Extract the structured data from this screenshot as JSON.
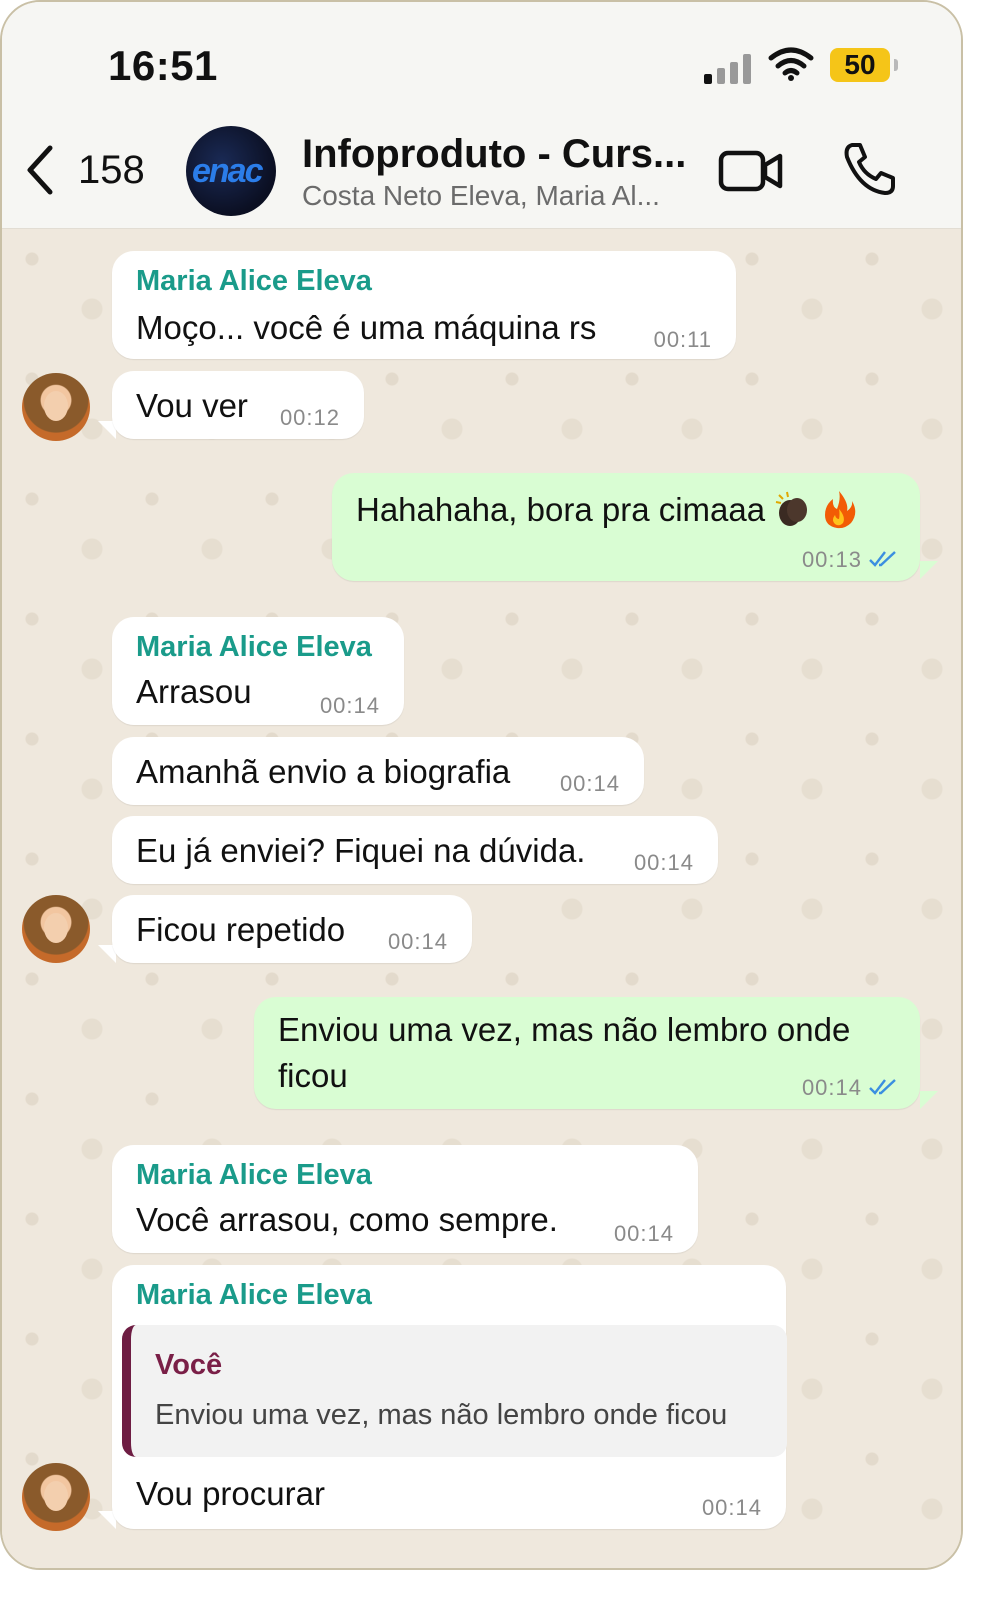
{
  "status": {
    "time": "16:51",
    "battery": "50"
  },
  "header": {
    "back_count": "158",
    "avatar_text": "enac",
    "title": "Infoproduto - Curs...",
    "subtitle": "Costa Neto Eleva, Maria Al..."
  },
  "messages": [
    {
      "type": "in",
      "sender": "Maria Alice Eleva",
      "text": "Moço... você é uma máquina rs",
      "time": "00:11"
    },
    {
      "type": "in",
      "text": "Vou ver",
      "time": "00:12"
    },
    {
      "type": "out",
      "text": "Hahahaha, bora pra cimaaa",
      "emojis": [
        "clapping-hands",
        "fire"
      ],
      "time": "00:13",
      "status": "read"
    },
    {
      "type": "in",
      "sender": "Maria Alice Eleva",
      "text": "Arrasou",
      "time": "00:14"
    },
    {
      "type": "in",
      "text": "Amanhã envio a biografia",
      "time": "00:14"
    },
    {
      "type": "in",
      "text": "Eu já enviei? Fiquei na dúvida.",
      "time": "00:14"
    },
    {
      "type": "in",
      "text": "Ficou repetido",
      "time": "00:14"
    },
    {
      "type": "out",
      "text_line1": "Enviou uma vez, mas não lembro onde",
      "text_line2": "ficou",
      "time": "00:14",
      "status": "read"
    },
    {
      "type": "in",
      "sender": "Maria Alice Eleva",
      "text": "Você arrasou, como sempre.",
      "time": "00:14"
    },
    {
      "type": "in",
      "sender": "Maria Alice Eleva",
      "quote": {
        "author": "Você",
        "text": "Enviou uma vez, mas não lembro onde ficou"
      },
      "text": "Vou procurar",
      "time": "00:14"
    }
  ],
  "colors": {
    "incoming": "#ffffff",
    "outgoing": "#d9fdd3",
    "sender": "#1a9b8a",
    "quote_author": "#7a1f47",
    "read_tick": "#3b8fe0"
  },
  "icons": [
    "back-chevron-icon",
    "video-call-icon",
    "voice-call-icon",
    "cellular-signal-icon",
    "wifi-icon",
    "battery-icon",
    "double-check-icon"
  ]
}
